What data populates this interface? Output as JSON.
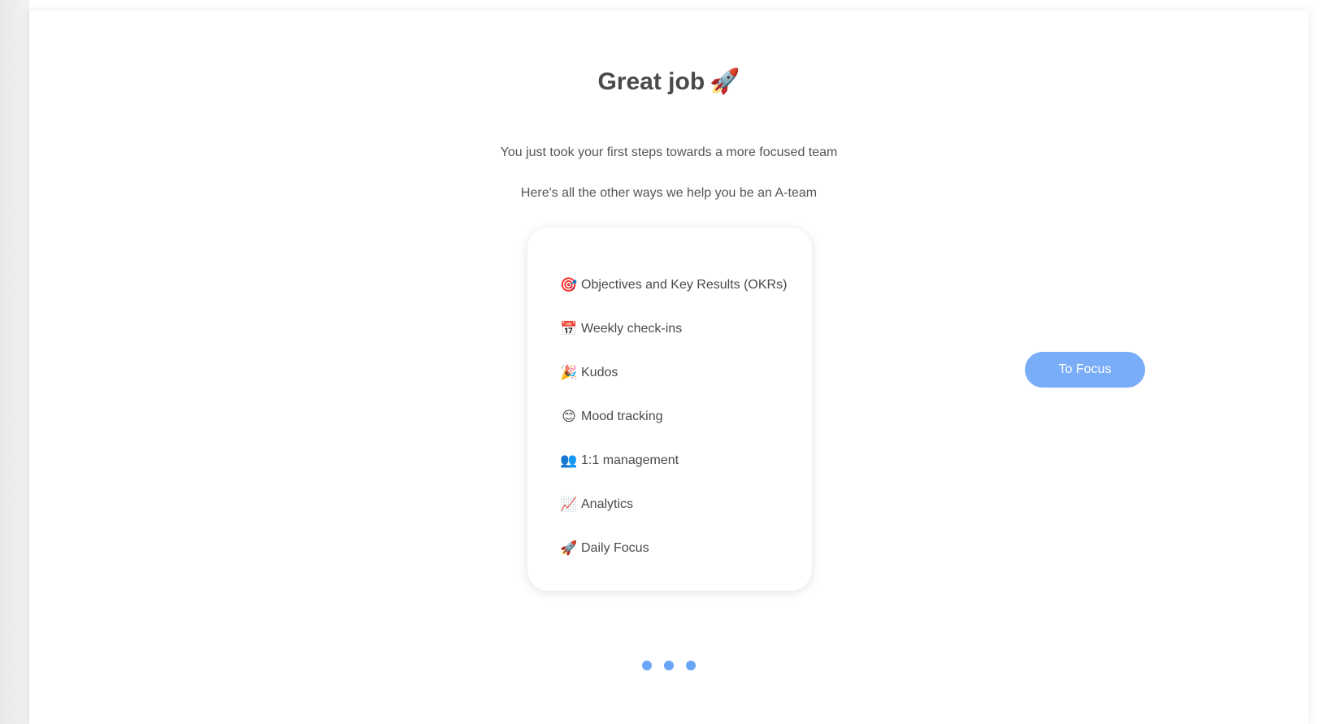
{
  "title": {
    "text": "Great job",
    "emoji": "🚀"
  },
  "subtitles": [
    "You just took your first steps towards a more focused team",
    "Here's all the other ways we help you be an A-team"
  ],
  "features": [
    {
      "icon": "🎯",
      "icon_name": "target-icon",
      "label": "Objectives and Key Results (OKRs)"
    },
    {
      "icon": "📅",
      "icon_name": "calendar-icon",
      "label": "Weekly check-ins"
    },
    {
      "icon": "🎉",
      "icon_name": "party-popper-icon",
      "label": "Kudos"
    },
    {
      "icon": "😊",
      "icon_name": "smiley-icon",
      "label": "Mood tracking"
    },
    {
      "icon": "👥",
      "icon_name": "people-icon",
      "label": "1:1 management"
    },
    {
      "icon": "📈",
      "icon_name": "chart-up-icon",
      "label": "Analytics"
    },
    {
      "icon": "🚀",
      "icon_name": "rocket-icon",
      "label": "Daily Focus"
    }
  ],
  "cta": {
    "label": "To Focus"
  },
  "pagination": {
    "count": 3,
    "active_index": 2
  },
  "colors": {
    "accent": "#79adf7",
    "dot": "#6aa6f7",
    "text": "#4a4a4a"
  }
}
